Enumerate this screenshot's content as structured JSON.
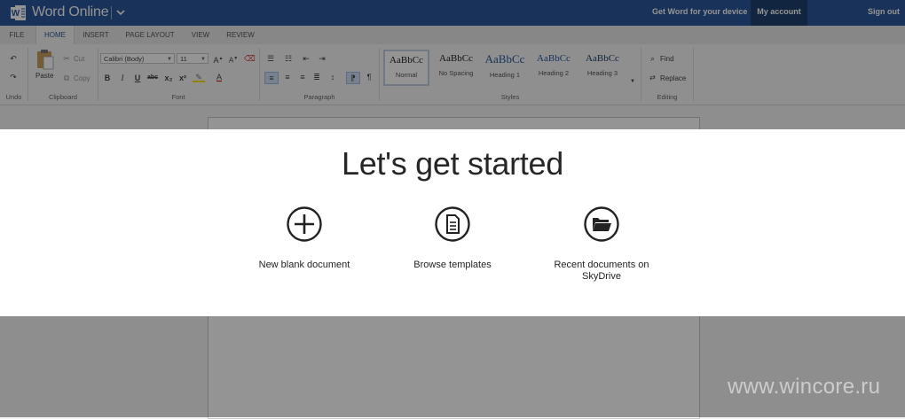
{
  "titlebar": {
    "app_title": "Word Online",
    "get_word": "Get Word for your device",
    "my_account": "My account",
    "sign_out": "Sign out"
  },
  "tabs": [
    {
      "label": "FILE"
    },
    {
      "label": "HOME"
    },
    {
      "label": "INSERT"
    },
    {
      "label": "PAGE LAYOUT"
    },
    {
      "label": "VIEW"
    },
    {
      "label": "REVIEW"
    }
  ],
  "ribbon": {
    "undo_group": "Undo",
    "clipboard": {
      "group": "Clipboard",
      "paste": "Paste",
      "cut": "Cut",
      "copy": "Copy"
    },
    "font": {
      "group": "Font",
      "name": "Calibri (Body)",
      "size": "11",
      "bold": "B",
      "italic": "I",
      "underline": "U",
      "strike": "abc",
      "subscript": "x₂",
      "superscript": "x²"
    },
    "paragraph": {
      "group": "Paragraph"
    },
    "styles": {
      "group": "Styles",
      "items": [
        {
          "preview": "AaBbCc",
          "name": "Normal"
        },
        {
          "preview": "AaBbCc",
          "name": "No Spacing"
        },
        {
          "preview": "AaBbCc",
          "name": "Heading 1"
        },
        {
          "preview": "AaBbCc",
          "name": "Heading 2"
        },
        {
          "preview": "AaBbCc",
          "name": "Heading 3"
        }
      ]
    },
    "editing": {
      "group": "Editing",
      "find": "Find",
      "replace": "Replace"
    }
  },
  "dialog": {
    "title": "Let's get started",
    "choices": [
      {
        "label": "New blank document",
        "icon": "plus-circle-icon"
      },
      {
        "label": "Browse templates",
        "icon": "document-icon"
      },
      {
        "label": "Recent documents on SkyDrive",
        "icon": "folder-open-icon"
      }
    ]
  },
  "watermark": "www.wincore.ru",
  "colors": {
    "brand": "#2b579a",
    "account_bg": "#1e3e6f"
  }
}
